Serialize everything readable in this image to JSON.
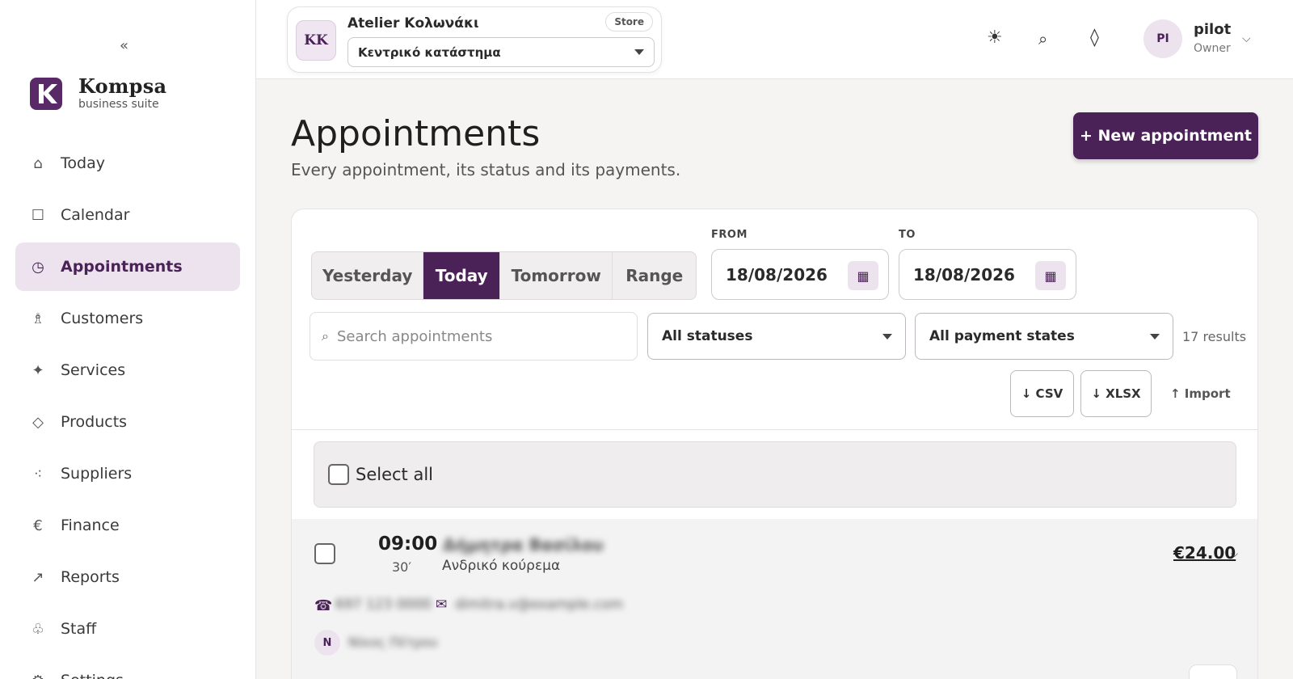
{
  "sidebar": {
    "collapse_label": "«",
    "brand_name": "Kompsa",
    "brand_sub": "business suite",
    "items": [
      {
        "label": "Today",
        "icon": "⌂"
      },
      {
        "label": "Calendar",
        "icon": "☐"
      },
      {
        "label": "Appointments",
        "icon": "◷",
        "active": true
      },
      {
        "label": "Customers",
        "icon": "♗"
      },
      {
        "label": "Services",
        "icon": "✦"
      },
      {
        "label": "Products",
        "icon": "◇"
      },
      {
        "label": "Suppliers",
        "icon": "⁖"
      },
      {
        "label": "Finance",
        "icon": "€"
      },
      {
        "label": "Reports",
        "icon": "↗"
      },
      {
        "label": "Staff",
        "icon": "♧"
      },
      {
        "label": "Settings",
        "icon": "⚙"
      }
    ]
  },
  "topbar": {
    "store": {
      "initials": "KK",
      "name": "Atelier Κολωνάκι",
      "badge": "Store",
      "location": "Κεντρικό κατάστημα"
    },
    "icons": {
      "theme": "☀",
      "search": "⌕",
      "diamond": "◊"
    },
    "user": {
      "initials": "PI",
      "name": "pilot",
      "role": "Owner",
      "chevron": "⌵"
    }
  },
  "header": {
    "title": "Appointments",
    "subtitle": "Every appointment, its status and its payments.",
    "new_button": "+ New appointment"
  },
  "filters": {
    "segments": [
      "Yesterday",
      "Today",
      "Tomorrow",
      "Range"
    ],
    "active_segment": "Today",
    "from_label": "FROM",
    "from_value": "18/08/2026",
    "to_label": "TO",
    "to_value": "18/08/2026",
    "calendar_icon": "▦",
    "search_icon": "⌕",
    "search_placeholder": "Search appointments",
    "status_value": "All statuses",
    "payment_value": "All payment states",
    "results": "17 results",
    "csv": "↓ CSV",
    "xlsx": "↓ XLSX",
    "import": "↑ Import"
  },
  "list": {
    "select_all": "Select all",
    "rows": [
      {
        "time": "09:00",
        "duration": "30′",
        "customer": "Δήμητρα Βασίλου",
        "service": "Ανδρικό κούρεμα",
        "price": "€24.00",
        "phone_icon": "☎",
        "phone": "697 123 0000",
        "mail_icon": "✉",
        "email": "dimitra.v@example.com",
        "staff_initial": "N",
        "staff": "Νίκος Πέτρου"
      }
    ]
  },
  "colors": {
    "accent": "#4b2257",
    "accent_soft": "#ece3ef"
  }
}
